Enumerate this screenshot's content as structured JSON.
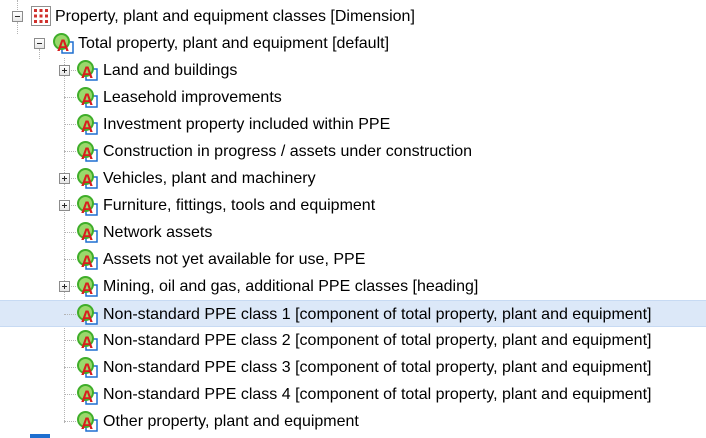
{
  "tree": {
    "root": {
      "label": "Property, plant and equipment classes [Dimension]",
      "icon": "dimension-grid-icon",
      "expanded": true
    },
    "default_member": {
      "label": "Total property, plant and equipment [default]",
      "icon": "abstract-element-icon",
      "expanded": true
    },
    "children": [
      {
        "label": "Land and buildings",
        "expandable": true,
        "selected": false,
        "icon": "abstract-element-icon"
      },
      {
        "label": "Leasehold improvements",
        "expandable": false,
        "selected": false,
        "icon": "abstract-element-icon"
      },
      {
        "label": "Investment property included within PPE",
        "expandable": false,
        "selected": false,
        "icon": "abstract-element-icon"
      },
      {
        "label": "Construction in progress / assets under construction",
        "expandable": false,
        "selected": false,
        "icon": "abstract-element-icon"
      },
      {
        "label": "Vehicles, plant and machinery",
        "expandable": true,
        "selected": false,
        "icon": "abstract-element-icon"
      },
      {
        "label": "Furniture, fittings, tools and equipment",
        "expandable": true,
        "selected": false,
        "icon": "abstract-element-icon"
      },
      {
        "label": "Network assets",
        "expandable": false,
        "selected": false,
        "icon": "abstract-element-icon"
      },
      {
        "label": "Assets not yet available for use, PPE",
        "expandable": false,
        "selected": false,
        "icon": "abstract-element-icon"
      },
      {
        "label": "Mining, oil and gas, additional PPE classes [heading]",
        "expandable": true,
        "selected": false,
        "icon": "abstract-element-icon"
      },
      {
        "label": "Non-standard PPE class 1 [component of total property, plant and equipment]",
        "expandable": false,
        "selected": true,
        "icon": "abstract-element-icon"
      },
      {
        "label": "Non-standard PPE class 2 [component of total property, plant and equipment]",
        "expandable": false,
        "selected": false,
        "icon": "abstract-element-icon"
      },
      {
        "label": "Non-standard PPE class 3 [component of total property, plant and equipment]",
        "expandable": false,
        "selected": false,
        "icon": "abstract-element-icon"
      },
      {
        "label": "Non-standard PPE class 4 [component of total property, plant and equipment]",
        "expandable": false,
        "selected": false,
        "icon": "abstract-element-icon"
      },
      {
        "label": "Other property, plant and equipment",
        "expandable": false,
        "selected": false,
        "icon": "abstract-element-icon"
      }
    ]
  },
  "colors": {
    "selection_background": "#dce8f8",
    "icon_circle": "#3fae2a",
    "icon_letter": "#d81e1e",
    "icon_square": "#1e6fd0",
    "grid_icon": "#d0312d"
  }
}
